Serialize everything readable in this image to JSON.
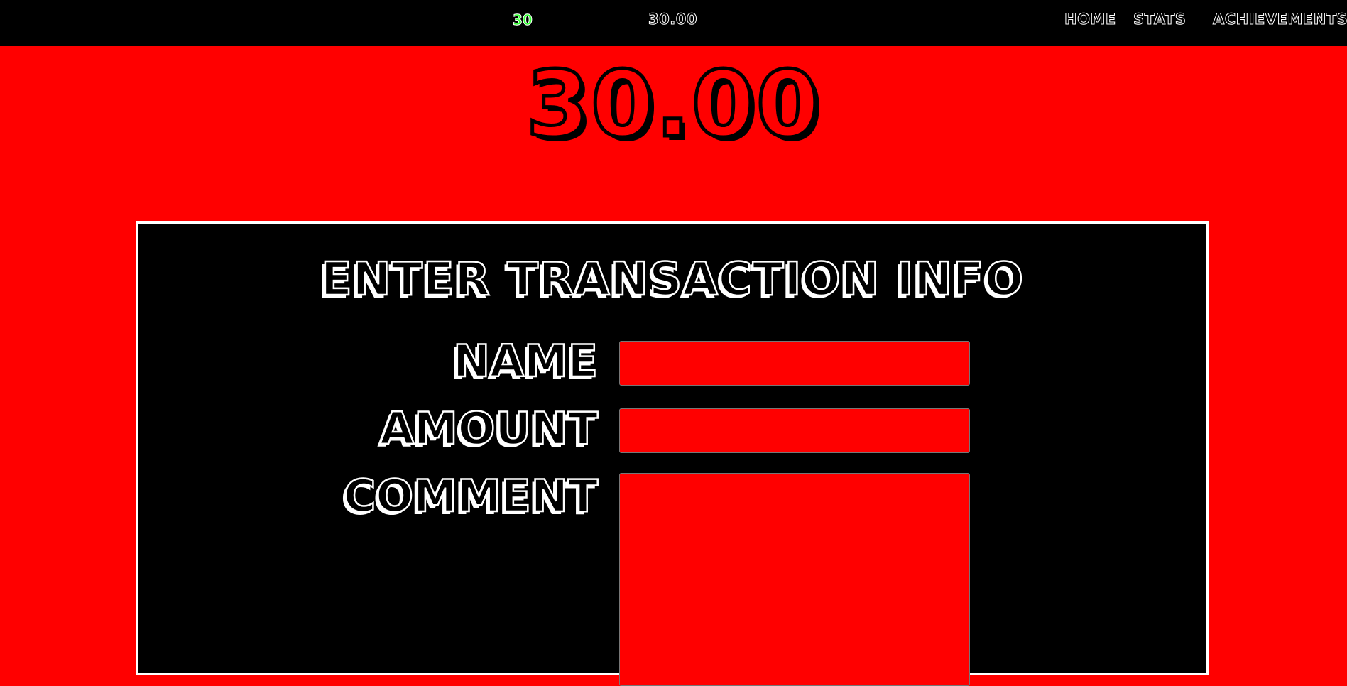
{
  "header": {
    "streak": "30",
    "balance": "30.00",
    "nav": {
      "home": "HOME",
      "stats": "STATS",
      "achievements": "ACHIEVEMENTS"
    }
  },
  "main": {
    "balance": "30.00"
  },
  "form": {
    "title": "ENTER TRANSACTION INFO",
    "name_label": "NAME",
    "name_value": "",
    "amount_label": "AMOUNT",
    "amount_value": "",
    "comment_label": "COMMENT",
    "comment_value": ""
  },
  "colors": {
    "background": "#ff0000",
    "topbar": "#000000",
    "panel": "#000000",
    "streak": "#33ff33",
    "input": "#ff0000"
  }
}
